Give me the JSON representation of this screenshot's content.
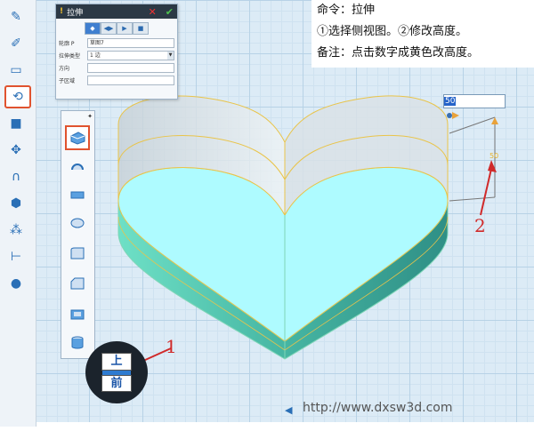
{
  "panel": {
    "title": "拉伸",
    "close_label": "✕",
    "ok_label": "✔",
    "mode_buttons": [
      "◆",
      "◀▶",
      "▶",
      "■"
    ],
    "rows": [
      {
        "label": "轮廓 P",
        "value": "草图7",
        "dropdown": false
      },
      {
        "label": "拉伸类型",
        "value": "1 边",
        "dropdown": true
      },
      {
        "label": "方向",
        "value": "",
        "dropdown": false
      },
      {
        "label": "子区域",
        "value": "",
        "dropdown": false
      }
    ],
    "pin_icon": "✦"
  },
  "instructions": {
    "line1": "命令：拉伸",
    "line2": "①选择侧视图。②修改高度。",
    "line3": "备注：点击数字成黄色改高度。"
  },
  "height_input": {
    "value": "50"
  },
  "dimension_label": "50",
  "annotations": {
    "one": "1",
    "two": "2"
  },
  "navcube": {
    "top_label": "上",
    "front_label": "前"
  },
  "watermark": "http://www.dxsw3d.com",
  "colors": {
    "accent_red": "#d02a2a",
    "active_border": "#e0532f",
    "solid_top": "#aefbff",
    "solid_side": "#4fa89a"
  }
}
